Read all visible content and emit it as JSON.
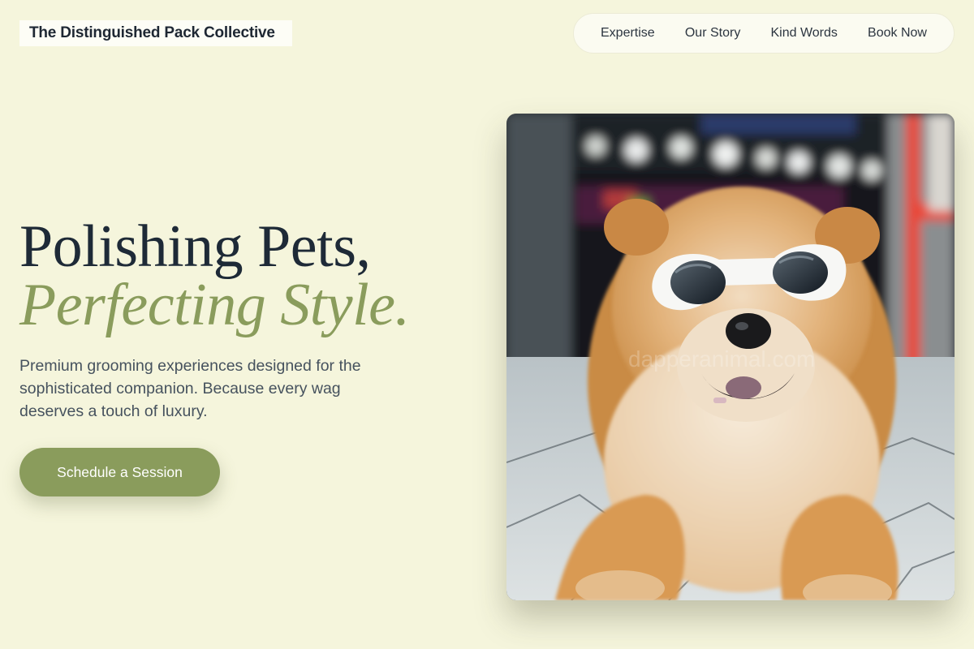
{
  "brand": {
    "name": "The Distinguished Pack Collective"
  },
  "nav": {
    "items": [
      {
        "label": "Expertise"
      },
      {
        "label": "Our Story"
      },
      {
        "label": "Kind Words"
      },
      {
        "label": "Book Now"
      }
    ]
  },
  "hero": {
    "headline_line1": "Polishing Pets,",
    "headline_line2": "Perfecting Style.",
    "subtitle": "Premium grooming experiences designed for the sophisticated companion. Because every wag deserves a touch of luxury.",
    "cta_label": "Schedule a Session",
    "image": {
      "watermark": "dapperanimal.com"
    }
  },
  "colors": {
    "background": "#f5f5dc",
    "accent": "#8a9c5c",
    "text_dark": "#1e2a37"
  }
}
